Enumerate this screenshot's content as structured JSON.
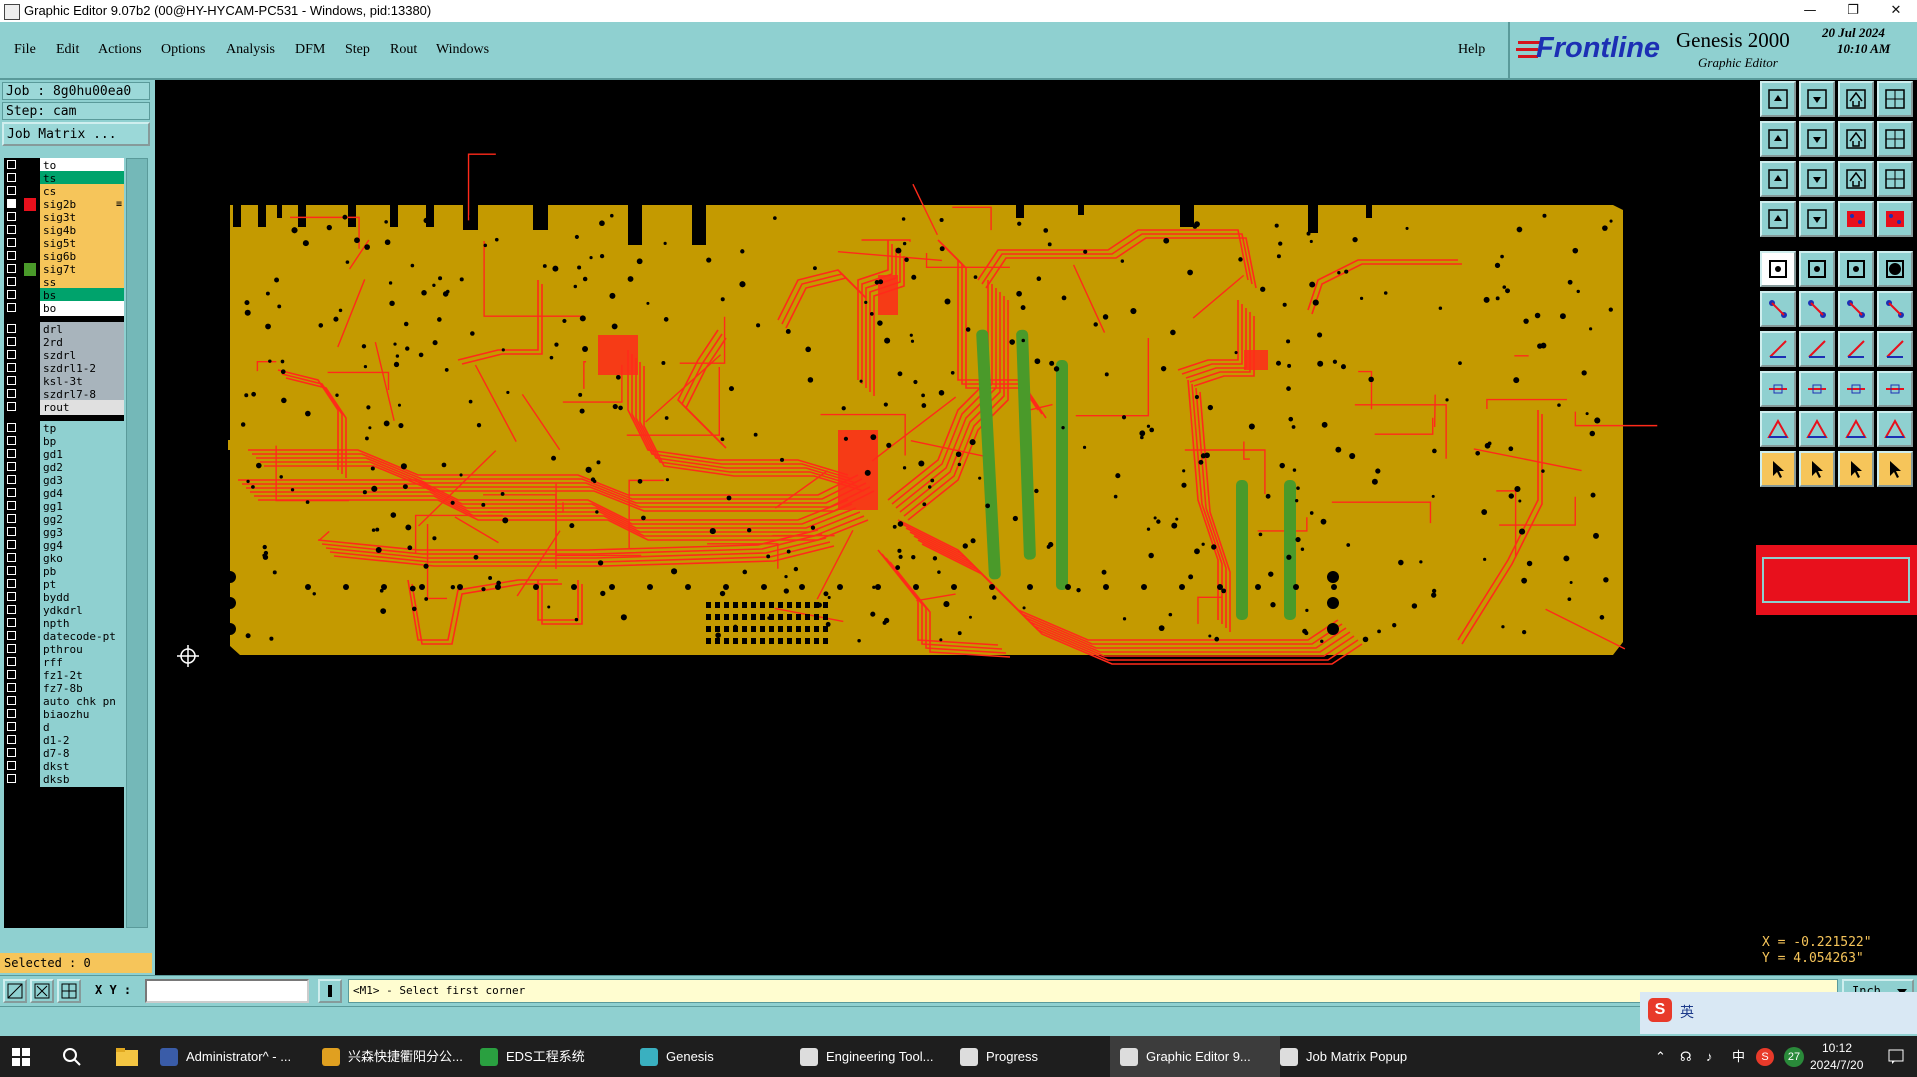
{
  "window": {
    "title": "Graphic Editor 9.07b2 (00@HY-HYCAM-PC531 - Windows, pid:13380)",
    "min": "—",
    "restore": "❐",
    "close": "✕"
  },
  "menu": {
    "items": [
      "File",
      "Edit",
      "Actions",
      "Options",
      "Analysis",
      "DFM",
      "Step",
      "Rout",
      "Windows"
    ],
    "help": "Help"
  },
  "brand": {
    "logo": "Frontline",
    "product": "Genesis 2000",
    "subtitle": "Graphic Editor",
    "date": "20 Jul 2024",
    "time": "10:10 AM"
  },
  "job": {
    "job_label": "Job : 8g0hu00ea0",
    "step_label": "Step: cam",
    "matrix_button": "Job Matrix ..."
  },
  "layers": [
    {
      "name": "to",
      "bg": "#ffffff",
      "swatch": "#000000"
    },
    {
      "name": "ts",
      "bg": "#00a36c",
      "swatch": "#000000"
    },
    {
      "name": "cs",
      "bg": "#f6c55a",
      "swatch": "#000000"
    },
    {
      "name": "sig2b",
      "bg": "#f6c55a",
      "swatch": "#e8101c",
      "active": true,
      "marker": "≡"
    },
    {
      "name": "sig3t",
      "bg": "#f6c55a",
      "swatch": "#000000"
    },
    {
      "name": "sig4b",
      "bg": "#f6c55a",
      "swatch": "#000000"
    },
    {
      "name": "sig5t",
      "bg": "#f6c55a",
      "swatch": "#000000"
    },
    {
      "name": "sig6b",
      "bg": "#f6c55a",
      "swatch": "#000000"
    },
    {
      "name": "sig7t",
      "bg": "#f6c55a",
      "swatch": "#4a9a2a"
    },
    {
      "name": "ss",
      "bg": "#f6c55a",
      "swatch": "#000000"
    },
    {
      "name": "bs",
      "bg": "#00a36c",
      "swatch": "#000000"
    },
    {
      "name": "bo",
      "bg": "#ffffff",
      "swatch": "#000000"
    },
    {
      "name": "drl",
      "bg": "#a8b4bc",
      "swatch": "#000000",
      "gap": true
    },
    {
      "name": "2rd",
      "bg": "#a8b4bc",
      "swatch": "#000000"
    },
    {
      "name": "szdrl",
      "bg": "#a8b4bc",
      "swatch": "#000000"
    },
    {
      "name": "szdrl1-2",
      "bg": "#a8b4bc",
      "swatch": "#000000"
    },
    {
      "name": "ksl-3t",
      "bg": "#a8b4bc",
      "swatch": "#000000"
    },
    {
      "name": "szdrl7-8",
      "bg": "#a8b4bc",
      "swatch": "#000000"
    },
    {
      "name": "rout",
      "bg": "#e0e0e0",
      "swatch": "#000000"
    },
    {
      "name": "tp",
      "bg": "#8fd0d0",
      "swatch": "#000000",
      "gap": true
    },
    {
      "name": "bp",
      "bg": "#8fd0d0",
      "swatch": "#000000"
    },
    {
      "name": "gd1",
      "bg": "#8fd0d0",
      "swatch": "#000000"
    },
    {
      "name": "gd2",
      "bg": "#8fd0d0",
      "swatch": "#000000"
    },
    {
      "name": "gd3",
      "bg": "#8fd0d0",
      "swatch": "#000000"
    },
    {
      "name": "gd4",
      "bg": "#8fd0d0",
      "swatch": "#000000"
    },
    {
      "name": "gg1",
      "bg": "#8fd0d0",
      "swatch": "#000000"
    },
    {
      "name": "gg2",
      "bg": "#8fd0d0",
      "swatch": "#000000"
    },
    {
      "name": "gg3",
      "bg": "#8fd0d0",
      "swatch": "#000000"
    },
    {
      "name": "gg4",
      "bg": "#8fd0d0",
      "swatch": "#000000"
    },
    {
      "name": "gko",
      "bg": "#8fd0d0",
      "swatch": "#000000"
    },
    {
      "name": "pb",
      "bg": "#8fd0d0",
      "swatch": "#000000"
    },
    {
      "name": "pt",
      "bg": "#8fd0d0",
      "swatch": "#000000"
    },
    {
      "name": "bydd",
      "bg": "#8fd0d0",
      "swatch": "#000000"
    },
    {
      "name": "ydkdrl",
      "bg": "#8fd0d0",
      "swatch": "#000000"
    },
    {
      "name": "npth",
      "bg": "#8fd0d0",
      "swatch": "#000000"
    },
    {
      "name": "datecode-pt",
      "bg": "#8fd0d0",
      "swatch": "#000000"
    },
    {
      "name": "pthrou",
      "bg": "#8fd0d0",
      "swatch": "#000000"
    },
    {
      "name": "rff",
      "bg": "#8fd0d0",
      "swatch": "#000000"
    },
    {
      "name": "fz1-2t",
      "bg": "#8fd0d0",
      "swatch": "#000000"
    },
    {
      "name": "fz7-8b",
      "bg": "#8fd0d0",
      "swatch": "#000000"
    },
    {
      "name": "auto_chk_pn",
      "bg": "#8fd0d0",
      "swatch": "#000000"
    },
    {
      "name": "biaozhu",
      "bg": "#8fd0d0",
      "swatch": "#000000"
    },
    {
      "name": "d",
      "bg": "#8fd0d0",
      "swatch": "#000000"
    },
    {
      "name": "d1-2",
      "bg": "#8fd0d0",
      "swatch": "#000000"
    },
    {
      "name": "d7-8",
      "bg": "#8fd0d0",
      "swatch": "#000000"
    },
    {
      "name": "dkst",
      "bg": "#8fd0d0",
      "swatch": "#000000"
    },
    {
      "name": "dksb",
      "bg": "#8fd0d0",
      "swatch": "#000000"
    }
  ],
  "selection": {
    "label": "Selected : 0"
  },
  "coords": {
    "x": "X = -0.221522\"",
    "y": "Y = 4.054263\""
  },
  "command": {
    "xy_label": "X Y :",
    "xy_value": "",
    "prompt": "<M1> - Select first corner",
    "units": "Inch"
  },
  "colors": {
    "panel": "#8fd0d0",
    "board": "#c49a00",
    "trace": "#ff2a1a",
    "pad": "#000000",
    "green_layer": "#4a9a2a",
    "highlight": "#f6c55a"
  },
  "taskbar": {
    "items": [
      {
        "label": "Administrator^ - ..."
      },
      {
        "label": "兴森快捷衢阳分公..."
      },
      {
        "label": "EDS工程系统"
      },
      {
        "label": "Genesis"
      },
      {
        "label": "Engineering Tool..."
      },
      {
        "label": "Progress"
      },
      {
        "label": "Graphic Editor 9..."
      },
      {
        "label": "Job Matrix Popup"
      }
    ],
    "ime": "英",
    "lang": "中",
    "badge": "27",
    "time": "10:12",
    "date": "2024/7/20"
  },
  "toolbar_icons": [
    "load-icon",
    "save-icon",
    "home-icon",
    "split-icon",
    "pan-left-icon",
    "pan-right-icon",
    "undo-view-icon",
    "redraw-icon",
    "zoom-fit-icon",
    "zoom-center-icon",
    "scale-1-2-icon",
    "help-icon",
    "snapshot-icon",
    "grid-icon",
    "layer-red-icon",
    "layer-pair-icon",
    "pad-icon",
    "edit-shape-icon",
    "line-tool-icon",
    "circle-tool-icon",
    "connect-icon",
    "cross-icon",
    "node-icon",
    "move-node-icon",
    "angle-icon",
    "slash-icon",
    "arc-icon",
    "trace-split-icon",
    "feature-add-icon",
    "line-add-icon",
    "measure-icon",
    "group-icon",
    "triangle-icon",
    "triangle-a-icon",
    "triangle-b-icon",
    "triangle-c-icon",
    "pointer-icon",
    "pointer-2-icon",
    "pointer-3-icon",
    "pointer-4-icon"
  ]
}
